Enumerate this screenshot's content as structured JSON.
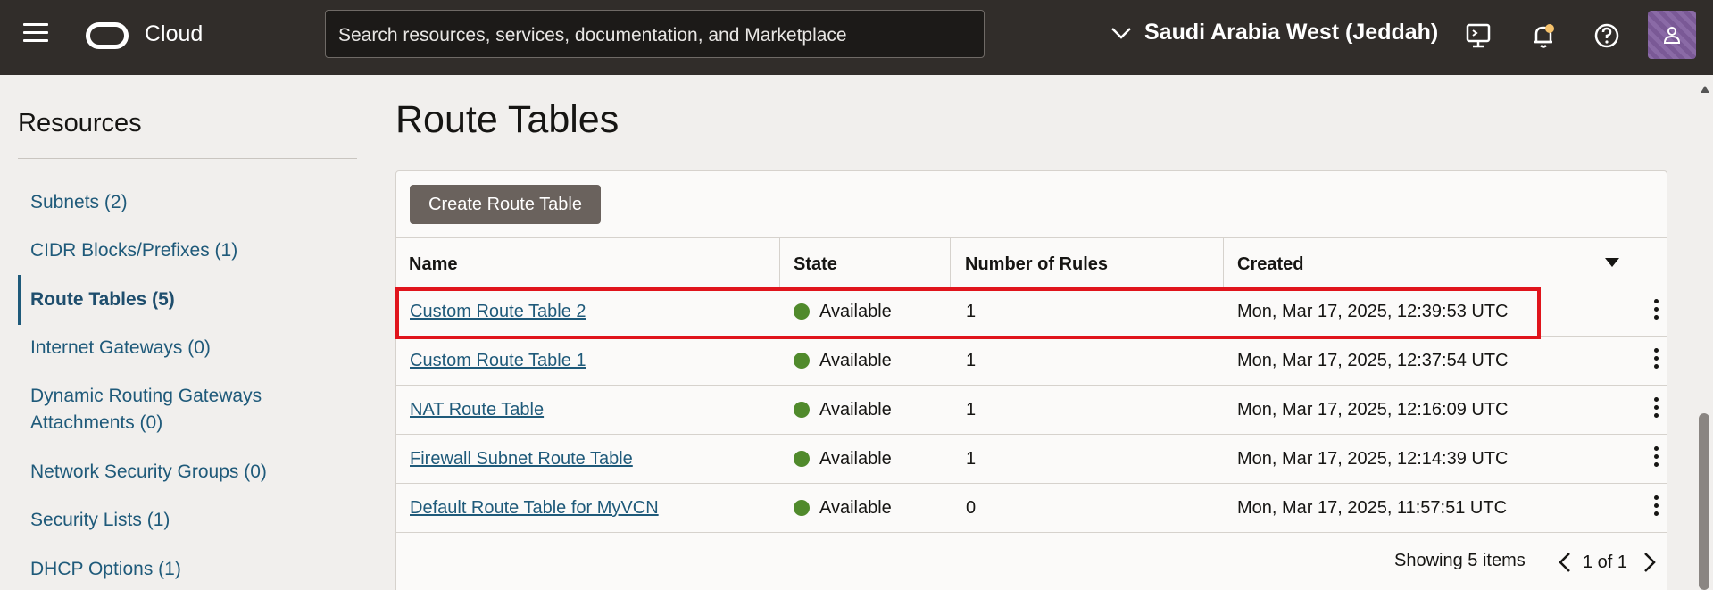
{
  "header": {
    "brand": "Cloud",
    "search_placeholder": "Search resources, services, documentation, and Marketplace",
    "region": "Saudi Arabia West (Jeddah)"
  },
  "sidebar": {
    "title": "Resources",
    "items": [
      {
        "label": "Subnets (2)"
      },
      {
        "label": "CIDR Blocks/Prefixes (1)"
      },
      {
        "label": "Route Tables (5)"
      },
      {
        "label": "Internet Gateways (0)"
      },
      {
        "label": "Dynamic Routing Gateways"
      },
      {
        "label": "Attachments (0)"
      },
      {
        "label": "Network Security Groups (0)"
      },
      {
        "label": "Security Lists (1)"
      },
      {
        "label": "DHCP Options (1)"
      }
    ]
  },
  "main": {
    "title": "Route Tables",
    "create_button": "Create Route Table",
    "columns": [
      "Name",
      "State",
      "Number of Rules",
      "Created"
    ],
    "rows": [
      {
        "name": "Custom Route Table 2",
        "state": "Available",
        "rules": "1",
        "created": "Mon, Mar 17, 2025, 12:39:53 UTC"
      },
      {
        "name": "Custom Route Table 1",
        "state": "Available",
        "rules": "1",
        "created": "Mon, Mar 17, 2025, 12:37:54 UTC"
      },
      {
        "name": "NAT Route Table",
        "state": "Available",
        "rules": "1",
        "created": "Mon, Mar 17, 2025, 12:16:09 UTC"
      },
      {
        "name": "Firewall Subnet Route Table",
        "state": "Available",
        "rules": "1",
        "created": "Mon, Mar 17, 2025, 12:14:39 UTC"
      },
      {
        "name": "Default Route Table for MyVCN",
        "state": "Available",
        "rules": "0",
        "created": "Mon, Mar 17, 2025, 11:57:51 UTC"
      }
    ],
    "footer_count": "Showing 5 items",
    "pager": "1 of 1"
  },
  "colors": {
    "header_bg": "#312d2a",
    "link": "#1f5a7a",
    "available_dot": "#508a2c",
    "highlight": "#e0141c",
    "button_bg": "#6a625d"
  },
  "icons": [
    "hamburger-icon",
    "oracle-logo-icon",
    "chevron-down-icon",
    "cloud-shell-icon",
    "bell-icon",
    "help-icon",
    "user-icon",
    "sort-down-icon",
    "kebab-icon",
    "chevron-left-icon",
    "chevron-right-icon"
  ]
}
